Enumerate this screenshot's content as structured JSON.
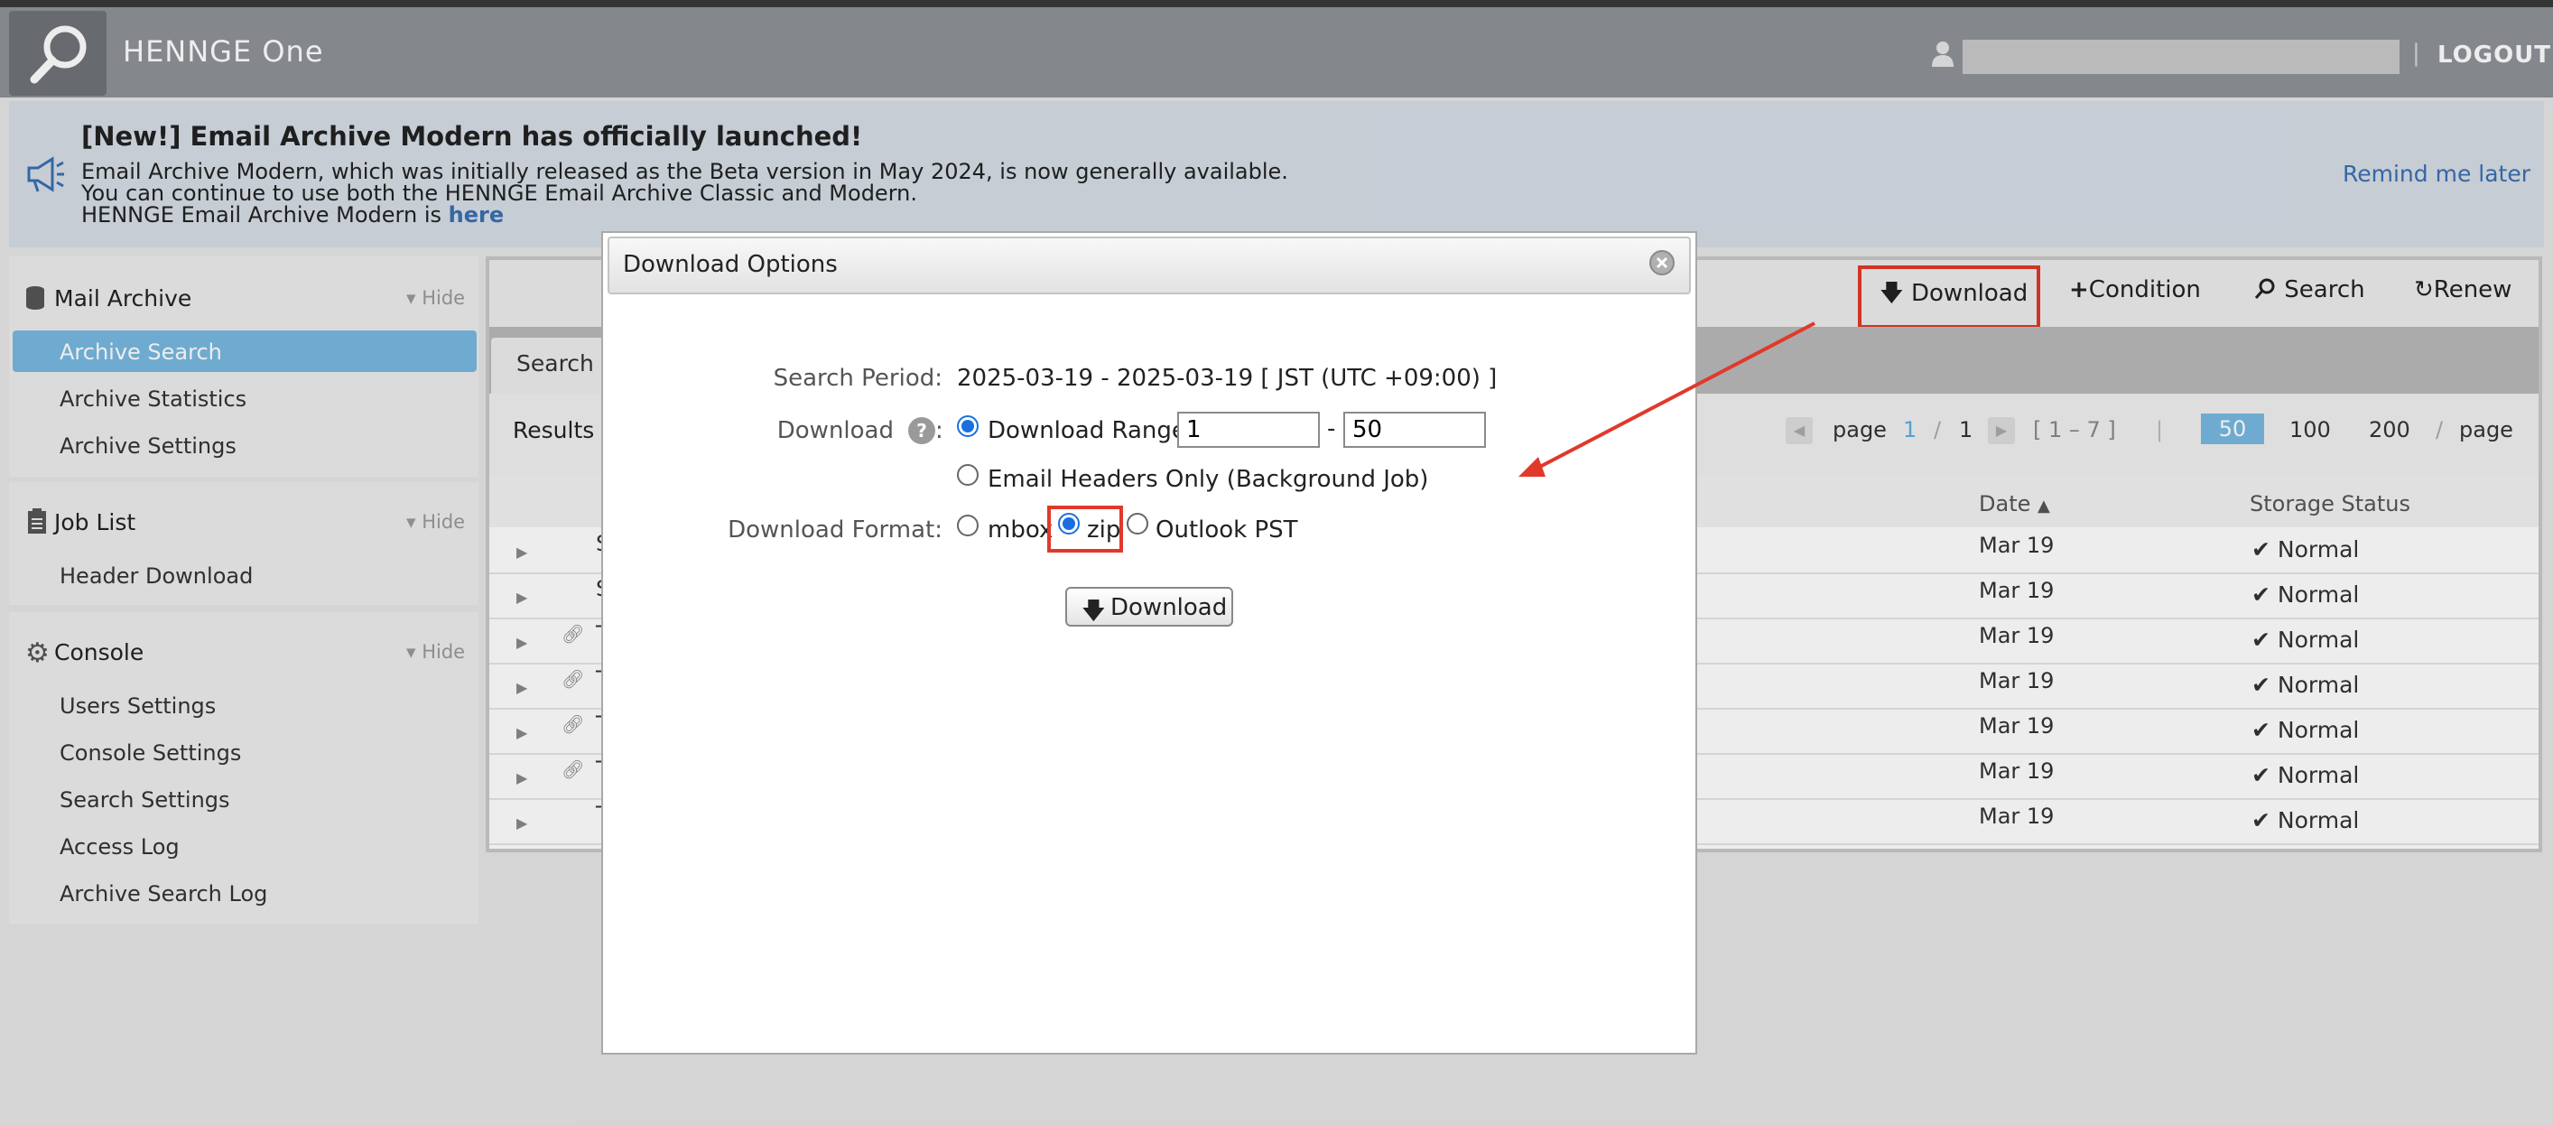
{
  "header": {
    "brand": "HENNGE One",
    "separator": "|",
    "logout_label": "LOGOUT"
  },
  "banner": {
    "title": "[New!] Email Archive Modern has officially launched!",
    "line1": "Email Archive Modern, which was initially released as the Beta version in May 2024, is now generally available.",
    "line2": "You can continue to use both the HENNGE Email Archive Classic and Modern.",
    "line3_prefix": "HENNGE Email Archive Modern is ",
    "line3_link": "here",
    "remind_label": "Remind me later"
  },
  "sidebar": {
    "sections": [
      {
        "title": "Mail Archive",
        "hide_label": "Hide",
        "items": [
          "Archive Search",
          "Archive Statistics",
          "Archive Settings"
        ]
      },
      {
        "title": "Job List",
        "hide_label": "Hide",
        "items": [
          "Header Download"
        ]
      },
      {
        "title": "Console",
        "hide_label": "Hide",
        "items": [
          "Users Settings",
          "Console Settings",
          "Search Settings",
          "Access Log",
          "Archive Search Log"
        ]
      }
    ],
    "active_item": "Archive Search"
  },
  "toolbar": {
    "download_label": "Download",
    "condition_label": "Condition",
    "search_label": "Search",
    "renew_label": "Renew"
  },
  "main": {
    "search_tab_partial": "Search F",
    "results_partial": "Results",
    "pagination": {
      "page_word": "page",
      "current": "1",
      "slash": "/",
      "total": "1",
      "range": "[ 1 – 7 ]",
      "divider": "|",
      "sizes": [
        "50",
        "100",
        "200"
      ],
      "selected_size": "50",
      "per_word": "page"
    },
    "columns": {
      "date": "Date",
      "storage": "Storage Status"
    },
    "rows": [
      {
        "prefix": "S",
        "date": "Mar 19",
        "status": "Normal",
        "attachment": false
      },
      {
        "prefix": "S",
        "date": "Mar 19",
        "status": "Normal",
        "attachment": false
      },
      {
        "prefix": "T",
        "date": "Mar 19",
        "status": "Normal",
        "attachment": true
      },
      {
        "prefix": "T",
        "date": "Mar 19",
        "status": "Normal",
        "attachment": true
      },
      {
        "prefix": "T",
        "date": "Mar 19",
        "status": "Normal",
        "attachment": true
      },
      {
        "prefix": "T",
        "date": "Mar 19",
        "status": "Normal",
        "attachment": true
      },
      {
        "prefix": "T",
        "date": "Mar 19",
        "status": "Normal",
        "attachment": false
      }
    ]
  },
  "dialog": {
    "title": "Download Options",
    "search_period_label": "Search Period:",
    "search_period_value": "2025-03-19 - 2025-03-19 [ JST (UTC +09:00) ]",
    "download_label": "Download",
    "colon": ":",
    "range_option": "Download Range",
    "range_from": "1",
    "range_dash": "-",
    "range_to": "50",
    "headers_option": "Email Headers Only (Background Job)",
    "format_label": "Download Format:",
    "formats": [
      "mbox",
      "zip",
      "Outlook PST"
    ],
    "selected_format": "zip",
    "download_button": "Download"
  },
  "annotation_color": "#e0392b",
  "accent_color": "#78b9e0"
}
